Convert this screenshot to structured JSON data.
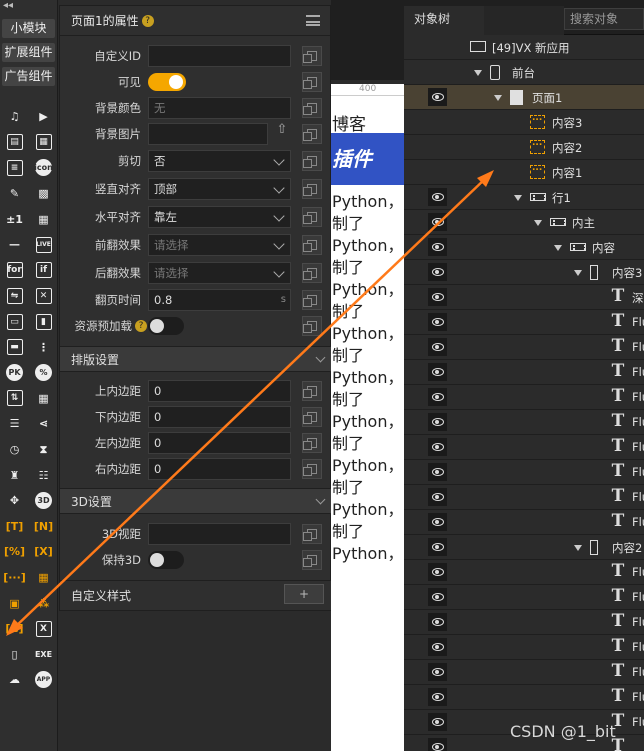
{
  "toolbar": {
    "buttons": [
      "小模块",
      "扩展组件",
      "广告组件"
    ],
    "icons": [
      "music-icon",
      "video-icon",
      "image-icon",
      "layout-icon",
      "edit-icon",
      "icon-icon",
      "brush-icon",
      "qr-icon",
      "plus-minus-icon",
      "qrcode-icon",
      "divider-icon",
      "live-icon",
      "for-icon",
      "if-icon",
      "form-icon",
      "shuffle-icon",
      "pk-icon",
      "percent-icon",
      "sort-icon",
      "table-icon",
      "tree-icon",
      "share-icon",
      "clock-icon",
      "hourglass-icon",
      "chart-icon",
      "ladder-icon",
      "move-icon",
      "3d-icon",
      "text-frame-icon",
      "n-frame-icon",
      "percent-frame-icon",
      "x-frame-icon",
      "container-icon",
      "grid-icon",
      "box-icon",
      "cubes-icon",
      "c-frame-icon",
      "excel-icon",
      "ios-icon",
      "exe-icon",
      "wechat-icon",
      "app-icon"
    ],
    "icon_labels": {
      "icon": "icon",
      "live": "LIVE",
      "for": "for",
      "if": "if",
      "pk": "PK",
      "percent": "%",
      "3d": "3D",
      "exe": "EXE",
      "app": "APP",
      "pm": "±1"
    }
  },
  "props": {
    "title": "页面1的属性",
    "rows": [
      {
        "label": "自定义ID",
        "value": "",
        "placeholder": ""
      },
      {
        "label": "可见"
      },
      {
        "label": "背景颜色",
        "value": "无"
      },
      {
        "label": "背景图片",
        "value": ""
      },
      {
        "label": "剪切",
        "value": "否"
      },
      {
        "label": "竖直对齐",
        "value": "顶部"
      },
      {
        "label": "水平对齐",
        "value": "靠左"
      },
      {
        "label": "前翻效果",
        "value": "请选择"
      },
      {
        "label": "后翻效果",
        "value": "请选择"
      },
      {
        "label": "翻页时间",
        "value": "0.8",
        "unit": "s"
      },
      {
        "label": "资源预加载"
      }
    ],
    "layout_section": "排版设置",
    "layout_rows": [
      {
        "label": "上内边距",
        "value": "0"
      },
      {
        "label": "下内边距",
        "value": "0"
      },
      {
        "label": "左内边距",
        "value": "0"
      },
      {
        "label": "右内边距",
        "value": "0"
      }
    ],
    "section_3d": "3D设置",
    "rows_3d": [
      {
        "label": "3D视距",
        "value": ""
      },
      {
        "label": "保持3D"
      }
    ],
    "custom_style": "自定义样式",
    "add_label": "+",
    "visible_on": true,
    "preload_on": false,
    "keep3d_on": false
  },
  "canvas": {
    "ruler_number": "400",
    "line1": "博客",
    "banner": "插件",
    "lines": [
      "Python，",
      "制了",
      "Python，",
      "制了",
      "Python，",
      "制了",
      "Python，",
      "制了",
      "Python，",
      "制了",
      "Python，",
      "制了",
      "Python，",
      "制了",
      "Python，"
    ]
  },
  "tree": {
    "tab": "对象树",
    "search_placeholder": "搜索对象",
    "nodes": [
      {
        "label": "[49]VX 新应用",
        "icon": "app",
        "indent": 0,
        "eye": false,
        "arrow": false
      },
      {
        "label": "前台",
        "icon": "phone",
        "indent": 1,
        "eye": false,
        "arrow": true
      },
      {
        "label": "页面1",
        "icon": "page",
        "indent": 2,
        "eye": true,
        "arrow": true,
        "selected": true
      },
      {
        "label": "内容3",
        "icon": "c",
        "indent": 3,
        "eye": false,
        "arrow": false
      },
      {
        "label": "内容2",
        "icon": "c",
        "indent": 3,
        "eye": false,
        "arrow": false
      },
      {
        "label": "内容1",
        "icon": "c",
        "indent": 3,
        "eye": false,
        "arrow": false
      },
      {
        "label": "行1",
        "icon": "row",
        "indent": 3,
        "eye": true,
        "arrow": true
      },
      {
        "label": "内主",
        "icon": "row",
        "indent": 4,
        "eye": true,
        "arrow": true
      },
      {
        "label": "内容",
        "icon": "row",
        "indent": 5,
        "eye": true,
        "arrow": true
      },
      {
        "label": "内容3",
        "icon": "col",
        "indent": 6,
        "eye": true,
        "arrow": true
      },
      {
        "label": "深度学",
        "icon": "T",
        "indent": 7,
        "eye": true,
        "arrow": false
      },
      {
        "label": "Flutter",
        "icon": "T",
        "indent": 7,
        "eye": true,
        "arrow": false
      },
      {
        "label": "Flutter",
        "icon": "T",
        "indent": 7,
        "eye": true,
        "arrow": false
      },
      {
        "label": "Flutter",
        "icon": "T",
        "indent": 7,
        "eye": true,
        "arrow": false
      },
      {
        "label": "Flutter",
        "icon": "T",
        "indent": 7,
        "eye": true,
        "arrow": false
      },
      {
        "label": "Flutter",
        "icon": "T",
        "indent": 7,
        "eye": true,
        "arrow": false
      },
      {
        "label": "Flutter",
        "icon": "T",
        "indent": 7,
        "eye": true,
        "arrow": false
      },
      {
        "label": "Flutter",
        "icon": "T",
        "indent": 7,
        "eye": true,
        "arrow": false
      },
      {
        "label": "Flutter",
        "icon": "T",
        "indent": 7,
        "eye": true,
        "arrow": false
      },
      {
        "label": "Flutter",
        "icon": "T",
        "indent": 7,
        "eye": true,
        "arrow": false
      },
      {
        "label": "内容2",
        "icon": "col",
        "indent": 6,
        "eye": true,
        "arrow": true
      },
      {
        "label": "Flutter",
        "icon": "T",
        "indent": 7,
        "eye": true,
        "arrow": false
      },
      {
        "label": "Flutter",
        "icon": "T",
        "indent": 7,
        "eye": true,
        "arrow": false
      },
      {
        "label": "Flutter",
        "icon": "T",
        "indent": 7,
        "eye": true,
        "arrow": false
      },
      {
        "label": "Flutter",
        "icon": "T",
        "indent": 7,
        "eye": true,
        "arrow": false
      },
      {
        "label": "Flutter",
        "icon": "T",
        "indent": 7,
        "eye": true,
        "arrow": false
      },
      {
        "label": "Flutter",
        "icon": "T",
        "indent": 7,
        "eye": true,
        "arrow": false
      },
      {
        "label": "Flutter",
        "icon": "T",
        "indent": 7,
        "eye": true,
        "arrow": false
      },
      {
        "label": "",
        "icon": "T",
        "indent": 7,
        "eye": true,
        "arrow": false
      }
    ]
  },
  "watermark": "CSDN @1_bit",
  "colors": {
    "accent": "#f5a700",
    "annotation_arrow": "#ff7a1a",
    "banner": "#3153c4",
    "selected_row": "#4a4233"
  }
}
